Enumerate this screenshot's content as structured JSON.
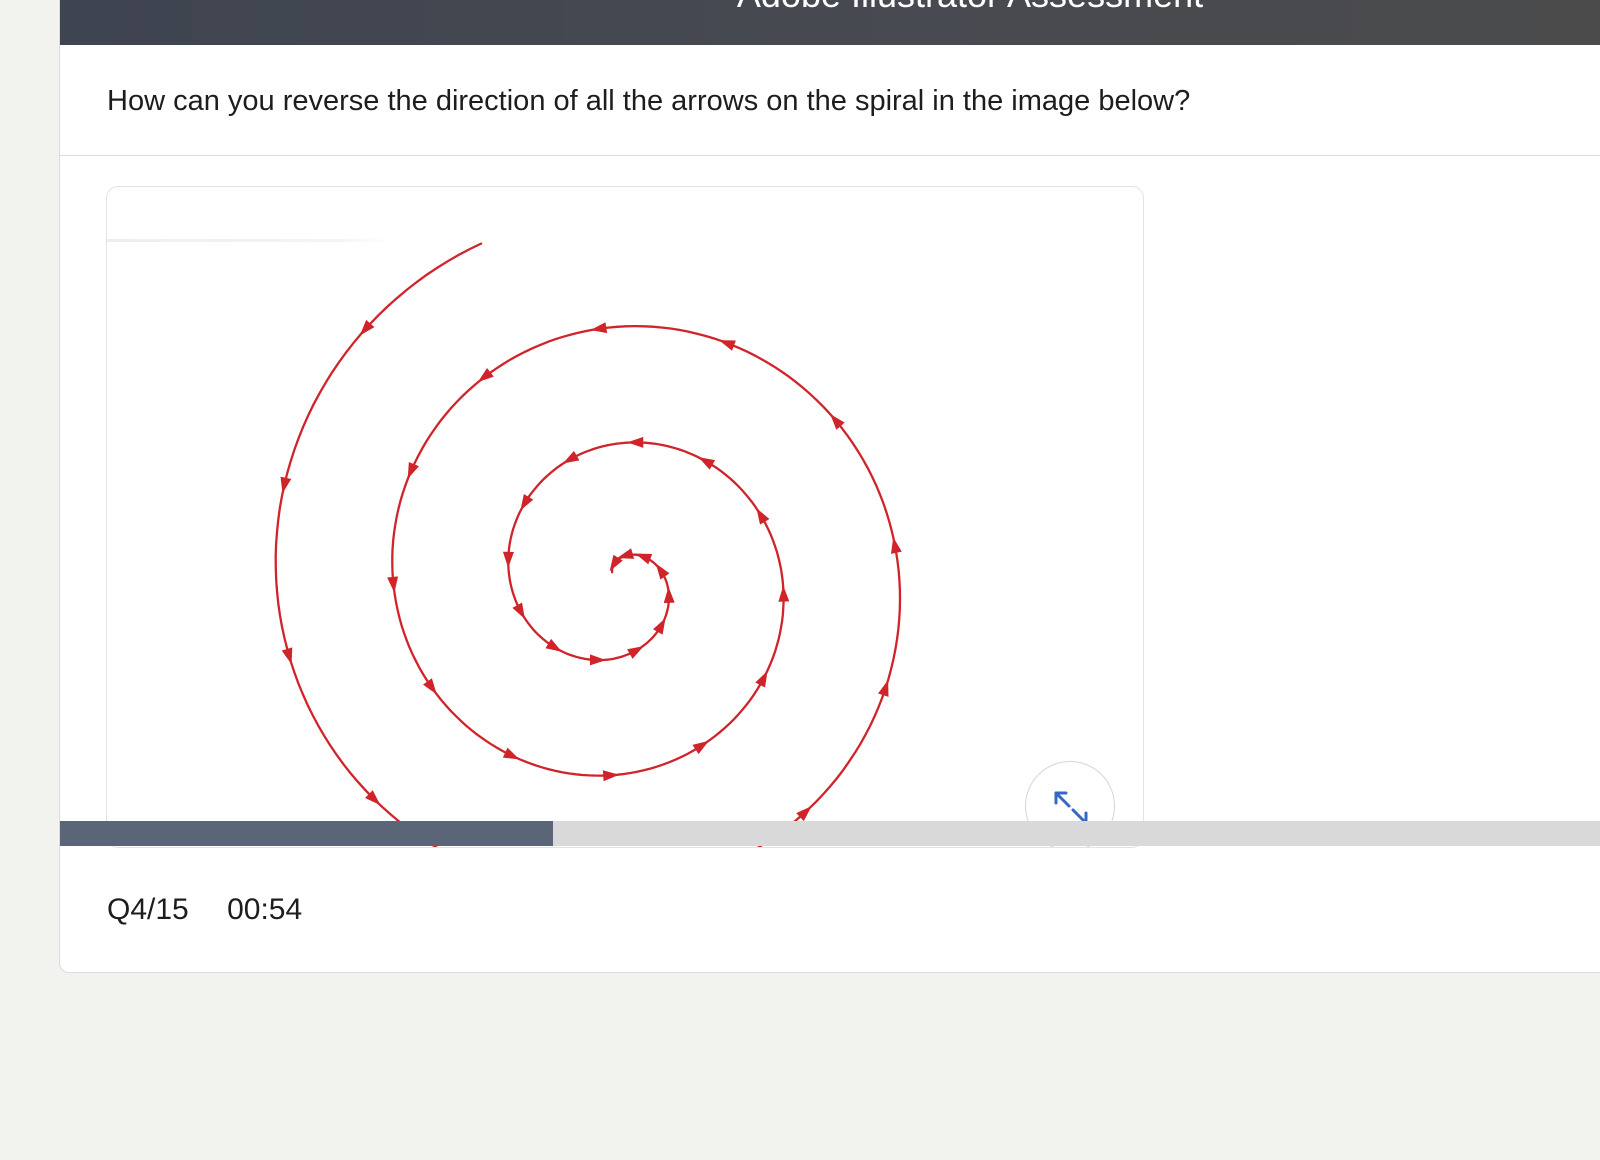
{
  "header": {
    "title": "Adobe Illustrator Assessment"
  },
  "question": {
    "text": "How can you reverse the direction of all the arrows on the spiral in the image below?"
  },
  "media": {
    "illustration": "red-spiral-with-arrowheads",
    "stroke_color": "#d0242b",
    "expand_icon": "expand-arrows-icon",
    "expand_icon_color": "#3567c4"
  },
  "progress": {
    "fraction": 0.32,
    "fill_color": "#5a6577",
    "track_color": "#d9d9da"
  },
  "footer": {
    "question_counter": "Q4/15",
    "timer": "00:54"
  }
}
